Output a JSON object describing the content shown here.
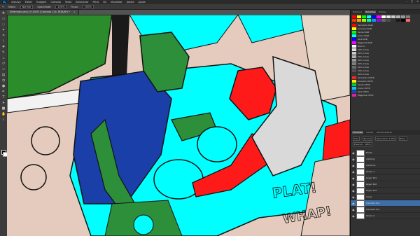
{
  "app": {
    "logo": "Ps"
  },
  "menu": [
    "Arquivo",
    "Editar",
    "Imagem",
    "Camada",
    "Texto",
    "Selecionar",
    "Filtro",
    "3D",
    "Visualizar",
    "Janela",
    "Ajuda"
  ],
  "options": {
    "mode_label": "Modo:",
    "mode_value": "Normal",
    "opacity_label": "Opacidade:",
    "opacity_value": "100%",
    "flow_label": "Fluxo:",
    "flow_value": "100%"
  },
  "document_tab": {
    "title": "SillematicLand_0f 100% (Camada 114, RGB/8*) *"
  },
  "panels": {
    "tabs": [
      "Histórico",
      "Amostras",
      "Estilos"
    ],
    "swatches": [
      "#ff0000",
      "#ffff00",
      "#00ff00",
      "#00ffff",
      "#0000ff",
      "#ff00ff",
      "#ffffff",
      "#e6e6e6",
      "#cccccc",
      "#b3b3b3",
      "#999999",
      "#808080",
      "#ff3300",
      "#ff9900",
      "#99ff00",
      "#00ff99",
      "#0099ff",
      "#9900ff",
      "#666666",
      "#4d4d4d",
      "#333333",
      "#1a1a1a",
      "#000000",
      "#ff6666"
    ],
    "styles": [
      {
        "color": "#ff0000",
        "name": "Vermelho RGB"
      },
      {
        "color": "#ffff00",
        "name": "Amarelo RGB"
      },
      {
        "color": "#00ff00",
        "name": "Verde RGB"
      },
      {
        "color": "#00ffff",
        "name": "Ciano RGB"
      },
      {
        "color": "#0000ff",
        "name": "Azul RGB"
      },
      {
        "color": "#ff00ff",
        "name": "Magenta RGB"
      },
      {
        "color": "#ffffff",
        "name": "Branco"
      },
      {
        "color": "#e0e0e0",
        "name": "10% Cinza"
      },
      {
        "color": "#c8c8c8",
        "name": "20% Cinza"
      },
      {
        "color": "#b0b0b0",
        "name": "30% Cinza"
      },
      {
        "color": "#989898",
        "name": "40% Cinza"
      },
      {
        "color": "#808080",
        "name": "50% Cinza"
      },
      {
        "color": "#686868",
        "name": "60% Cinza"
      },
      {
        "color": "#505050",
        "name": "70% Cinza"
      },
      {
        "color": "#383838",
        "name": "80% Cinza"
      },
      {
        "color": "#ff2020",
        "name": "Vermelho CMYK"
      },
      {
        "color": "#ffee00",
        "name": "Amarelo CMYK"
      },
      {
        "color": "#00cc44",
        "name": "Verde CMYK"
      },
      {
        "color": "#00ccee",
        "name": "Ciano CMYK"
      },
      {
        "color": "#2040c0",
        "name": "Azul CMYK"
      },
      {
        "color": "#e020a0",
        "name": "Magenta CMYK"
      }
    ],
    "layers_tabs": [
      "Camadas",
      "Canais",
      "Demarcadores"
    ],
    "layer_options": {
      "kind": "Tipo",
      "blend": "Normal",
      "opacity": "Opacidade: 100%",
      "lock": "Bloq.:",
      "fill": "Preench.: 100%"
    },
    "layers": [
      {
        "name": "Fundo",
        "selected": false
      },
      {
        "name": "coloring",
        "selected": false
      },
      {
        "name": "contorno",
        "selected": false
      },
      {
        "name": "Grupo 1",
        "selected": false
      },
      {
        "name": "Layer 101",
        "selected": false
      },
      {
        "name": "Layer 102",
        "selected": false
      },
      {
        "name": "Layer 103",
        "selected": false
      },
      {
        "name": "cores",
        "selected": false
      },
      {
        "name": "Camada 114",
        "selected": true
      },
      {
        "name": "Camada 113",
        "selected": false
      },
      {
        "name": "Grupo 2",
        "selected": false
      }
    ]
  },
  "canvas": {
    "sfx_text_1": "PLAT!",
    "sfx_text_2": "WHAP!"
  }
}
